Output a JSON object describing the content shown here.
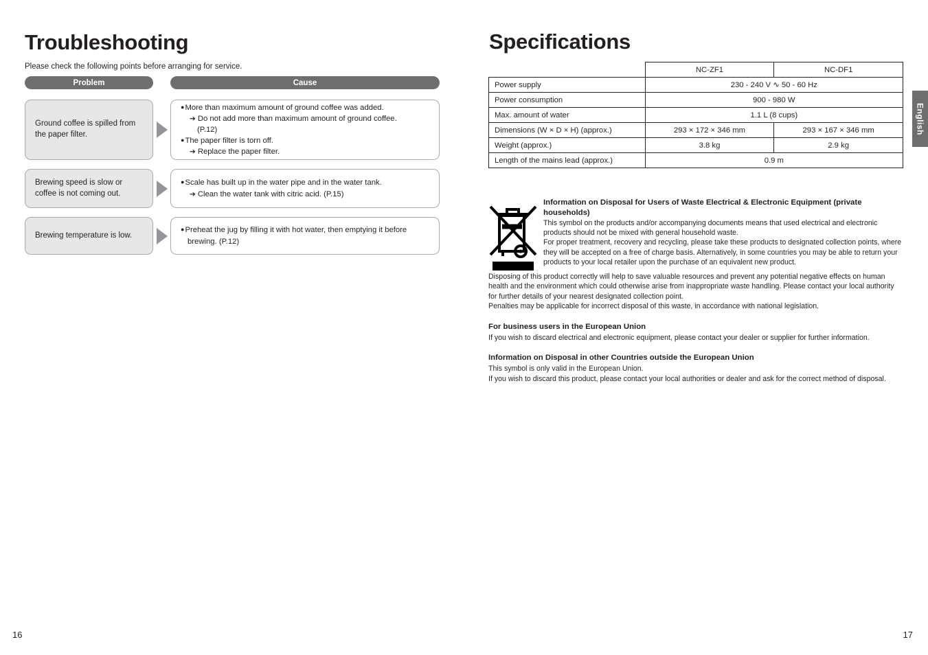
{
  "left_page": {
    "title": "Troubleshooting",
    "subtitle": "Please check the following points before arranging for service.",
    "headers": {
      "problem": "Problem",
      "cause": "Cause"
    },
    "rows": [
      {
        "problem": "Ground coffee is spilled from the paper filter.",
        "causes": [
          {
            "bullet": "More than maximum amount of ground coffee was added.",
            "sub": "Do not add more than maximum amount of ground coffee.",
            "cont": "(P.12)"
          },
          {
            "bullet": "The paper filter is torn off.",
            "sub": "Replace the paper filter.",
            "cont": ""
          }
        ]
      },
      {
        "problem": "Brewing speed is slow or coffee is not coming out.",
        "causes": [
          {
            "bullet": "Scale has built up in the water pipe and in the water tank.",
            "sub": "Clean the water tank with citric acid. (P.15)",
            "cont": ""
          }
        ]
      },
      {
        "problem": "Brewing temperature is low.",
        "causes": [
          {
            "bullet": "Preheat the jug by filling it with hot water, then emptying it before brewing. (P.12)",
            "sub": "",
            "cont": ""
          }
        ]
      }
    ],
    "page_number": "16"
  },
  "right_page": {
    "title": "Specifications",
    "spec_table": {
      "column_headers": [
        "",
        "NC-ZF1",
        "NC-DF1"
      ],
      "rows": [
        {
          "label": "Power supply",
          "span": true,
          "values": [
            "230 - 240 V ∿ 50 - 60 Hz"
          ]
        },
        {
          "label": "Power consumption",
          "span": true,
          "values": [
            "900 - 980 W"
          ]
        },
        {
          "label": "Max. amount of water",
          "span": true,
          "values": [
            "1.1 L (8 cups)"
          ]
        },
        {
          "label": "Dimensions (W × D × H) (approx.)",
          "span": false,
          "values": [
            "293 × 172 × 346 mm",
            "293 × 167 × 346 mm"
          ]
        },
        {
          "label": "Weight (approx.)",
          "span": false,
          "values": [
            "3.8 kg",
            "2.9 kg"
          ]
        },
        {
          "label": "Length of the mains lead (approx.)",
          "span": true,
          "values": [
            "0.9 m"
          ]
        }
      ]
    },
    "weee": {
      "icon_name": "crossed-out-wheeled-bin-icon",
      "heading": "Information on Disposal for Users of Waste Electrical & Electronic Equipment (private households)",
      "para1": "This symbol on the products and/or accompanying documents means that used electrical and electronic products should not be mixed with general household waste.",
      "para2": "For proper treatment, recovery and recycling, please take these products to designated collection points, where they will be accepted on a free of charge basis. Alternatively, in some countries you may be able to return your products to your local retailer upon the purchase of an equivalent new product.",
      "para3": "Disposing of this product correctly will help to save valuable resources and prevent any potential negative effects on human health and the environment which could otherwise arise from inappropriate waste handling. Please contact your local authority for further details of your nearest designated collection point.",
      "para4": "Penalties may be applicable for incorrect disposal of this waste, in accordance with national legislation.",
      "business_heading": "For business users in the European Union",
      "business_text": "If you wish to discard electrical and electronic equipment, please contact your dealer or supplier for further information.",
      "outside_eu_heading": "Information on Disposal in other Countries outside the European Union",
      "outside_eu_text1": "This symbol is only valid in the European Union.",
      "outside_eu_text2": "If you wish to discard this product, please contact your local authorities or dealer and ask for the correct method of disposal."
    },
    "side_tab_label": "English",
    "page_number": "17"
  },
  "colors": {
    "header_pill": "#6d6e70",
    "problem_box": "#e6e7e8",
    "box_border": "#a7a9ac",
    "arrow": "#939598",
    "text": "#231f20"
  }
}
